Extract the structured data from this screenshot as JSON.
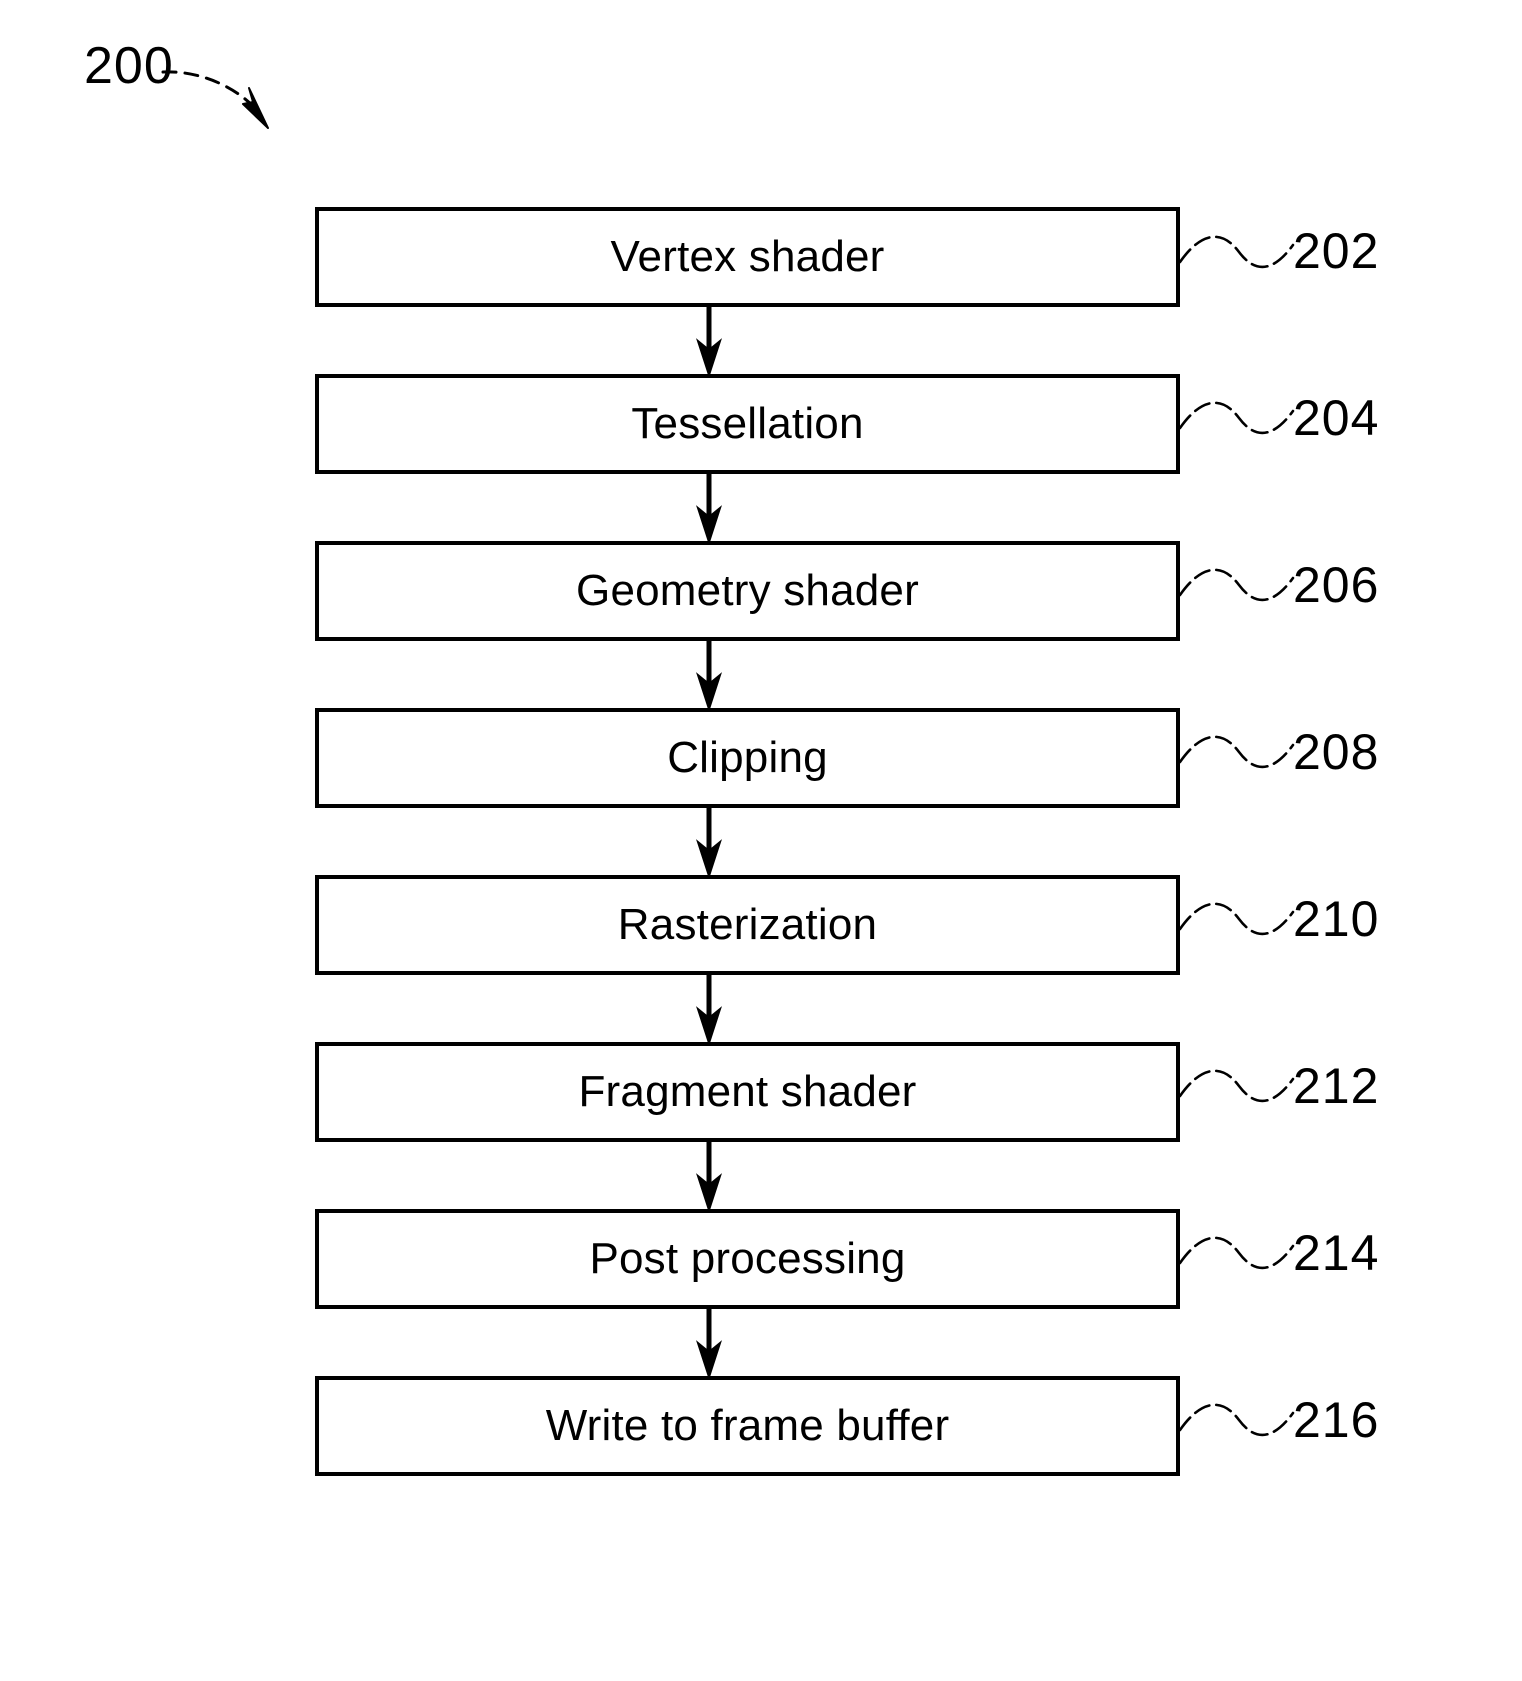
{
  "figure": {
    "number": "200",
    "type": "patent-flowchart",
    "title_label": "200"
  },
  "steps": [
    {
      "label": "Vertex shader",
      "ref": "202"
    },
    {
      "label": "Tessellation",
      "ref": "204"
    },
    {
      "label": "Geometry shader",
      "ref": "206"
    },
    {
      "label": "Clipping",
      "ref": "208"
    },
    {
      "label": "Rasterization",
      "ref": "210"
    },
    {
      "label": "Fragment shader",
      "ref": "212"
    },
    {
      "label": "Post processing",
      "ref": "214"
    },
    {
      "label": "Write to frame buffer",
      "ref": "216"
    }
  ],
  "colors": {
    "stroke": "#000000",
    "fill": "#ffffff",
    "text": "#000000"
  }
}
